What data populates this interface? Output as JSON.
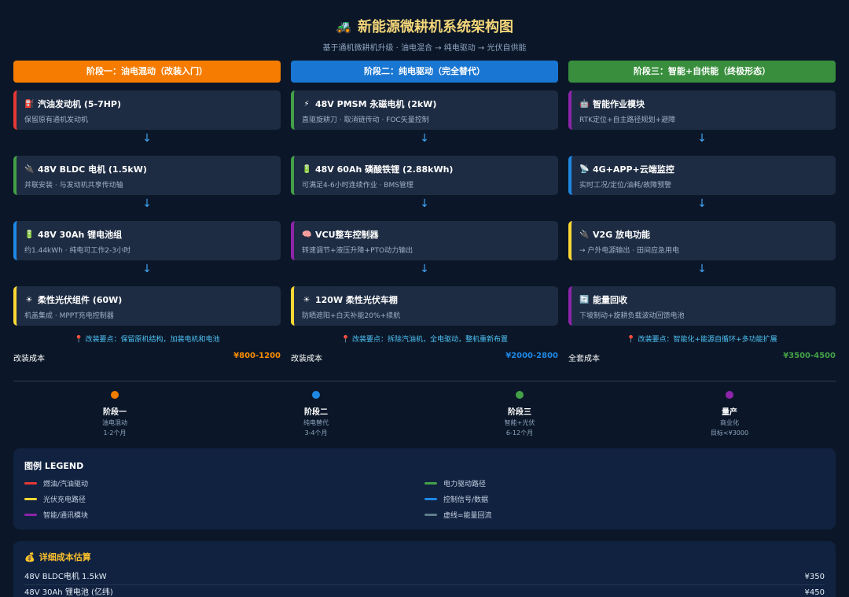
{
  "header": {
    "title_icon": "🚜",
    "title": "新能源微耕机系统架构图",
    "subtitle": "基于通机微耕机升级 · 油电混合 → 纯电驱动 → 光伏自供能"
  },
  "stages": [
    {
      "head": "阶段一：油电混动（改装入门）",
      "cards": [
        {
          "icon": "⛽",
          "title": "汽油发动机 (5-7HP)",
          "desc": "保留原有通机发动机",
          "border": "red"
        },
        {
          "icon": "🔌",
          "title": "48V BLDC 电机 (1.5kW)",
          "desc": "并联安装 · 与发动机共享传动轴",
          "border": "green"
        },
        {
          "icon": "🔋",
          "title": "48V 30Ah 锂电池组",
          "desc": "约1.44kWh · 纯电可工作2-3小时",
          "border": "blue"
        },
        {
          "icon": "☀",
          "title": "柔性光伏组件 (60W)",
          "desc": "机盖集成 · MPPT充电控制器",
          "border": "yellow"
        }
      ],
      "note": "📍 改装要点：保留原机结构，加装电机和电池",
      "cost_label": "改装成本",
      "cost_value": "¥800-1200"
    },
    {
      "head": "阶段二：纯电驱动（完全替代）",
      "cards": [
        {
          "icon": "⚡",
          "title": "48V PMSM 永磁电机 (2kW)",
          "desc": "直驱旋耕刀 · 取消链传动 · FOC矢量控制",
          "border": "green"
        },
        {
          "icon": "🔋",
          "title": "48V 60Ah 磷酸铁锂 (2.88kWh)",
          "desc": "可满足4-6小时连续作业 · BMS管理",
          "border": "green"
        },
        {
          "icon": "🧠",
          "title": "VCU整车控制器",
          "desc": "转速调节+液压升降+PTO动力输出",
          "border": "purple"
        },
        {
          "icon": "☀",
          "title": "120W 柔性光伏车棚",
          "desc": "防晒遮阳+白天补能20%+续航",
          "border": "yellow"
        }
      ],
      "note": "📍 改装要点：拆除汽油机，全电驱动，整机重新布置",
      "cost_label": "改装成本",
      "cost_value": "¥2000-2800"
    },
    {
      "head": "阶段三：智能+自供能（终极形态）",
      "cards": [
        {
          "icon": "🤖",
          "title": "智能作业模块",
          "desc": "RTK定位+自主路径规划+避障",
          "border": "purple"
        },
        {
          "icon": "📡",
          "title": "4G+APP+云端监控",
          "desc": "实时工况/定位/油耗/故障预警",
          "border": "blue"
        },
        {
          "icon": "🔌",
          "title": "V2G 放电功能",
          "desc": "→ 户外电源输出 · 田间应急用电",
          "border": "yellow"
        },
        {
          "icon": "🔄",
          "title": "能量回收",
          "desc": "下坡制动+旋耕负载波动回馈电池",
          "border": "purple"
        }
      ],
      "note": "📍 改装要点：智能化+能源自循环+多功能扩展",
      "cost_label": "全套成本",
      "cost_value": "¥3500-4500"
    }
  ],
  "arrow": "↓",
  "timeline": [
    {
      "name": "阶段一",
      "l1": "油电混动",
      "l2": "1-2个月",
      "color": "#f57c00"
    },
    {
      "name": "阶段二",
      "l1": "纯电替代",
      "l2": "3-4个月",
      "color": "#1e88e5"
    },
    {
      "name": "阶段三",
      "l1": "智能+光伏",
      "l2": "6-12个月",
      "color": "#43a047"
    },
    {
      "name": "量产",
      "l1": "商业化",
      "l2": "目标<¥3000",
      "color": "#8e24aa"
    }
  ],
  "legend": {
    "title": "图例 LEGEND",
    "items": [
      {
        "label": "燃油/汽油驱动",
        "color": "#e53935"
      },
      {
        "label": "电力驱动路径",
        "color": "#43a047"
      },
      {
        "label": "光伏充电路径",
        "color": "#fdd835"
      },
      {
        "label": "控制信号/数据",
        "color": "#1e88e5"
      },
      {
        "label": "智能/通讯模块",
        "color": "#8e24aa"
      },
      {
        "label": "虚线=能量回流",
        "color": "#607d8b"
      }
    ]
  },
  "costs": {
    "icon": "💰",
    "title": "详细成本估算",
    "items": [
      {
        "name": "48V BLDC电机 1.5kW",
        "price": "¥350"
      },
      {
        "name": "48V 30Ah 锂电池 (亿纬)",
        "price": "¥450"
      }
    ]
  }
}
